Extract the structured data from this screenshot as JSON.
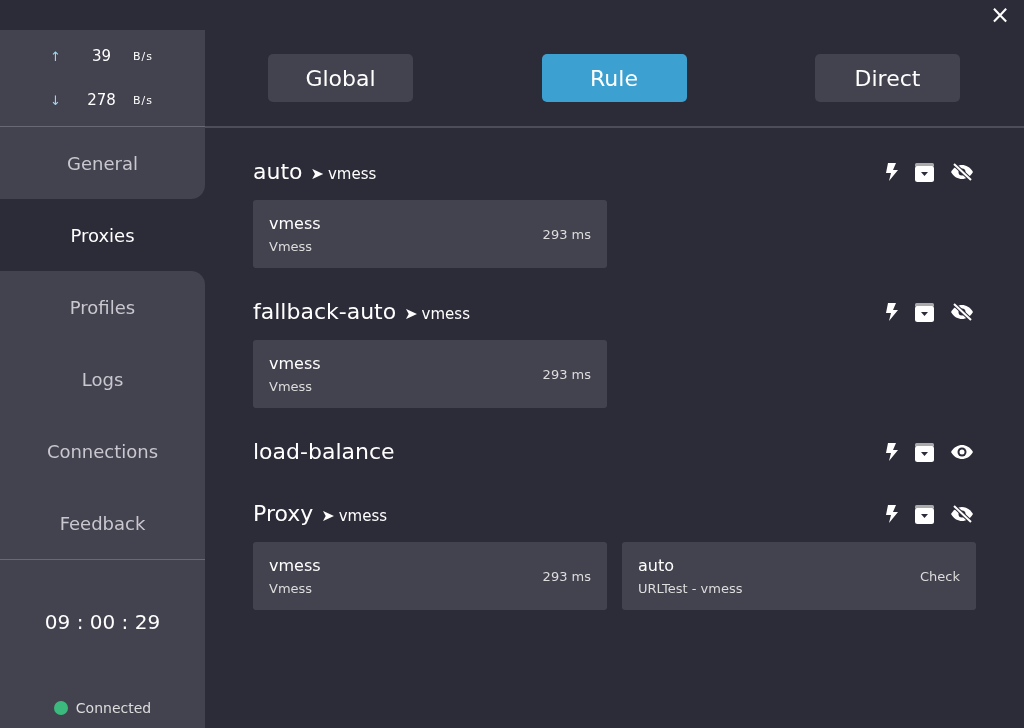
{
  "close_button": "×",
  "speed": [
    {
      "arrow": "↑",
      "value": "39",
      "unit": "B/s"
    },
    {
      "arrow": "↓",
      "value": "278",
      "unit": "B/s"
    }
  ],
  "sidebar": {
    "items": [
      {
        "label": "General",
        "selected": false
      },
      {
        "label": "Proxies",
        "selected": true
      },
      {
        "label": "Profiles",
        "selected": false
      },
      {
        "label": "Logs",
        "selected": false
      },
      {
        "label": "Connections",
        "selected": false
      },
      {
        "label": "Feedback",
        "selected": false
      }
    ]
  },
  "timer": "09 : 00 : 29",
  "status": {
    "label": "Connected",
    "color": "#3cba7e"
  },
  "modes": [
    {
      "label": "Global",
      "selected": false
    },
    {
      "label": "Rule",
      "selected": true
    },
    {
      "label": "Direct",
      "selected": false
    }
  ],
  "groups": [
    {
      "name": "auto",
      "arrow": "➤",
      "now": "vmess",
      "hidden": true,
      "proxies": [
        {
          "name": "vmess",
          "type": "Vmess",
          "delay": "293 ms"
        }
      ]
    },
    {
      "name": "fallback-auto",
      "arrow": "➤",
      "now": "vmess",
      "hidden": true,
      "proxies": [
        {
          "name": "vmess",
          "type": "Vmess",
          "delay": "293 ms"
        }
      ]
    },
    {
      "name": "load-balance",
      "hidden": false
    },
    {
      "name": "Proxy",
      "arrow": "➤",
      "now": "vmess",
      "hidden": true,
      "proxies": [
        {
          "name": "vmess",
          "type": "Vmess",
          "delay": "293 ms"
        },
        {
          "name": "auto",
          "type": "URLTest - vmess",
          "delay": "Check"
        }
      ]
    }
  ]
}
